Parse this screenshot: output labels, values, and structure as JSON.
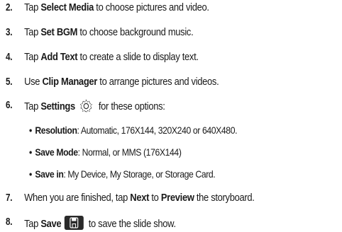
{
  "steps": [
    {
      "num": "2.",
      "pre": "Tap ",
      "bold": "Select Media",
      "post": " to choose pictures and video."
    },
    {
      "num": "3.",
      "pre": "Tap ",
      "bold": "Set BGM",
      "post": " to choose background music."
    },
    {
      "num": "4.",
      "pre": "Tap ",
      "bold": "Add Text",
      "post": " to create a slide to display text."
    },
    {
      "num": "5.",
      "pre": "Use ",
      "bold": "Clip Manager",
      "post": " to arrange pictures and videos."
    },
    {
      "num": "6.",
      "pre": "Tap ",
      "bold": "Settings",
      "post": " for these options:"
    },
    {
      "num": "7.",
      "pre": "When you are finished, tap ",
      "bold": "Next",
      "mid": " to ",
      "bold2": "Preview",
      "post": " the storyboard."
    },
    {
      "num": "8.",
      "pre": "Tap ",
      "bold": "Save",
      "post": " to save the slide show."
    }
  ],
  "options": [
    {
      "label": "Resolution",
      "text": ": Automatic, 176X144, 320X240 or 640X480."
    },
    {
      "label": "Save Mode",
      "text": ": Normal, or MMS (176X144)"
    },
    {
      "label": "Save in",
      "text": ": My Device, My Storage, or Storage Card."
    }
  ],
  "bullet_glyph": "•",
  "icons": {
    "settings": "gear-icon",
    "save": "save-icon"
  }
}
